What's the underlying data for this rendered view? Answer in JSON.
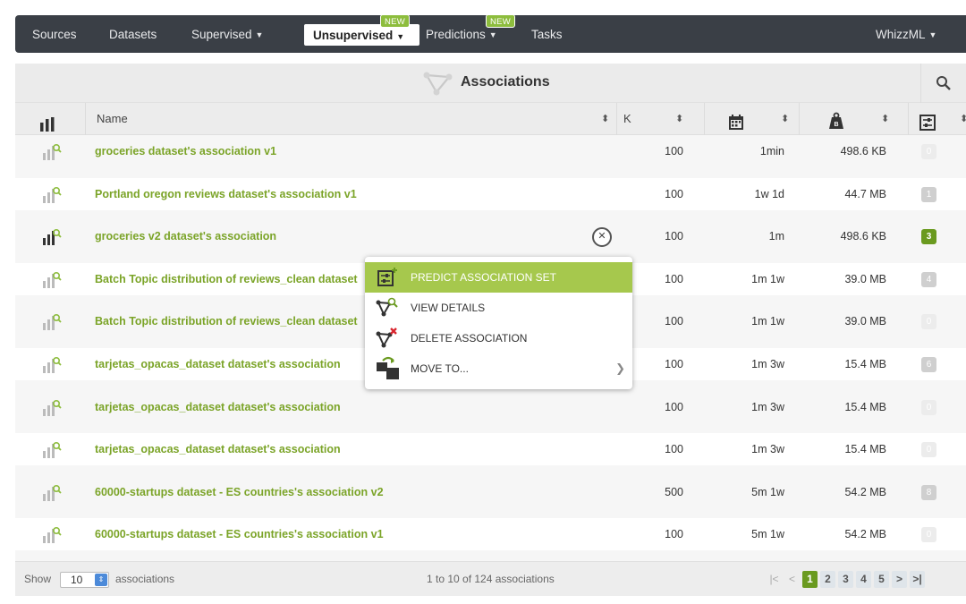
{
  "nav": {
    "items": [
      {
        "label": "Sources",
        "caret": false,
        "new": false
      },
      {
        "label": "Datasets",
        "caret": false,
        "new": false
      },
      {
        "label": "Supervised",
        "caret": true,
        "new": false
      },
      {
        "label": "Unsupervised",
        "caret": true,
        "new": true,
        "active": true
      },
      {
        "label": "Predictions",
        "caret": true,
        "new": true
      },
      {
        "label": "Tasks",
        "caret": false,
        "new": false
      }
    ],
    "right": {
      "label": "WhizzML",
      "caret": true
    },
    "new_badge": "NEW"
  },
  "list": {
    "title": "Associations",
    "columns": {
      "name": "Name",
      "k": "K"
    },
    "rows": [
      {
        "name": "groceries dataset's association v1",
        "k": "100",
        "age": "1min",
        "size": "498.6 KB",
        "count": "0"
      },
      {
        "name": "Portland oregon reviews dataset's association v1",
        "k": "100",
        "age": "1w 1d",
        "size": "44.7 MB",
        "count": "1"
      },
      {
        "name": "groceries v2 dataset's association",
        "k": "100",
        "age": "1m",
        "size": "498.6 KB",
        "count": "3"
      },
      {
        "name": "Batch Topic distribution of reviews_clean dataset",
        "k": "100",
        "age": "1m 1w",
        "size": "39.0 MB",
        "count": "4"
      },
      {
        "name": "Batch Topic distribution of reviews_clean dataset",
        "k": "100",
        "age": "1m 1w",
        "size": "39.0 MB",
        "count": "0"
      },
      {
        "name": "tarjetas_opacas_dataset dataset's association",
        "k": "100",
        "age": "1m 3w",
        "size": "15.4 MB",
        "count": "6"
      },
      {
        "name": "tarjetas_opacas_dataset dataset's association",
        "k": "100",
        "age": "1m 3w",
        "size": "15.4 MB",
        "count": "0"
      },
      {
        "name": "tarjetas_opacas_dataset dataset's association",
        "k": "100",
        "age": "1m 3w",
        "size": "15.4 MB",
        "count": "0"
      },
      {
        "name": "60000-startups dataset - ES countries's association v2",
        "k": "500",
        "age": "5m 1w",
        "size": "54.2 MB",
        "count": "8"
      },
      {
        "name": "60000-startups dataset - ES countries's association v1",
        "k": "100",
        "age": "5m 1w",
        "size": "54.2 MB",
        "count": "0"
      }
    ]
  },
  "menu": {
    "items": [
      {
        "label": "PREDICT ASSOCIATION SET",
        "icon": "predict-set-icon",
        "active": true
      },
      {
        "label": "VIEW DETAILS",
        "icon": "view-details-icon"
      },
      {
        "label": "DELETE ASSOCIATION",
        "icon": "delete-association-icon"
      },
      {
        "label": "MOVE TO...",
        "icon": "move-to-icon",
        "submenu": true
      }
    ]
  },
  "footer": {
    "show_label": "Show",
    "page_size": "10",
    "after_label": "associations",
    "range": "1 to 10 of 124 associations",
    "pages": [
      "1",
      "2",
      "3",
      "4",
      "5"
    ],
    "current_page": "1"
  },
  "colors": {
    "nav_bg": "#3a3f46",
    "accent_green": "#7ba428",
    "menu_highlight": "#a6c84d",
    "page_current": "#6a9a1f"
  }
}
